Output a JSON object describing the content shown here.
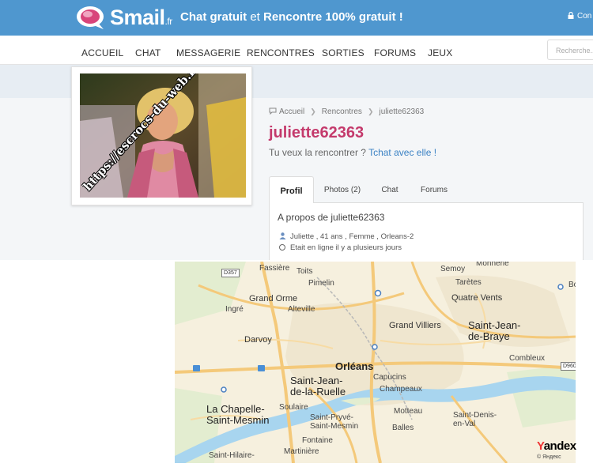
{
  "header": {
    "logo_text": "Smail",
    "logo_tld": ".fr",
    "tagline_part1": "Chat gratuit",
    "tagline_part2": " et ",
    "tagline_part3": "Rencontre 100% gratuit !",
    "login_label": "Con"
  },
  "nav": {
    "items": [
      "ACCUEIL",
      "CHAT",
      "MESSAGERIE",
      "RENCONTRES",
      "SORTIES",
      "FORUMS",
      "JEUX"
    ],
    "search_placeholder": "Recherche..."
  },
  "photo": {
    "watermark": "https://escrocs-du-web.fr"
  },
  "breadcrumb": {
    "items": [
      "Accueil",
      "Rencontres",
      "juliette62363"
    ]
  },
  "profile": {
    "username": "juliette62363",
    "subtitle_text": "Tu veux la rencontrer ? ",
    "subtitle_link": "Tchat avec elle !",
    "tabs": [
      "Profil",
      "Photos (2)",
      "Chat",
      "Forums"
    ],
    "about_title": "A propos de juliette62363",
    "details": "Juliette , 41 ans , Femme , Orleans-2",
    "status": "Etait en ligne il y a plusieurs jours"
  },
  "map": {
    "labels": {
      "fassiere": "Fassière",
      "toits": "Toits",
      "pimelin": "Pimelin",
      "semoy": "Semoy",
      "monnerie": "Monnerie",
      "tartes": "Tarètes",
      "bo": "Bo",
      "grand_orme": "Grand Orme",
      "quatre_vents": "Quatre Vents",
      "ingre": "Ingré",
      "alteville": "Alteville",
      "grand_villiers": "Grand Villiers",
      "saint_jean_braye": "Saint-Jean-\nde-Braye",
      "darvoy": "Darvoy",
      "orleans": "Orléans",
      "combleux": "Combleux",
      "saint_jean_ruelle": "Saint-Jean-\nde-la-Ruelle",
      "capucins": "Capucins",
      "champeaux": "Champeaux",
      "la_chapelle": "La Chapelle-\nSaint-Mesmin",
      "soulaire": "Soulaire",
      "motteau": "Motteau",
      "saint_pryve": "Saint-Pryvé-\nSaint-Mesmin",
      "saint_denis": "Saint-Denis-\nen-Val",
      "balles": "Balles",
      "fontaine": "Fontaine",
      "martiniere": "Martinière",
      "saint_hilaire": "Saint-Hilaire-"
    },
    "shields": {
      "d357": "D357",
      "d960": "D960"
    },
    "brand": "Yandex",
    "copyright": "© Яндекс"
  },
  "colors": {
    "header_bg": "#4f97cf",
    "username": "#c43a6c",
    "link": "#3b82c4",
    "river": "#a8d5ef",
    "road": "#f4c97a"
  }
}
